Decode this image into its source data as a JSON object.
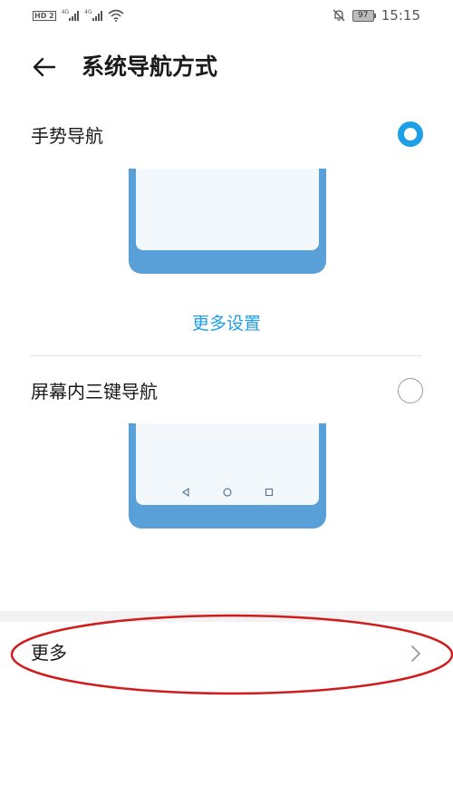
{
  "status_bar": {
    "hd_badge": "HD 2",
    "sim1_network": "4G",
    "sim2_network": "4G",
    "battery": "97",
    "time": "15:15",
    "icons": [
      "signal-icon",
      "wifi-icon",
      "mute-bell-icon",
      "battery-icon"
    ]
  },
  "header": {
    "title": "系统导航方式",
    "back_icon": "arrow-left-icon"
  },
  "options": [
    {
      "label": "手势导航",
      "selected": true,
      "more_settings": "更多设置"
    },
    {
      "label": "屏幕内三键导航",
      "selected": false,
      "nav_icons": [
        "triangle-back-icon",
        "circle-home-icon",
        "square-recent-icon"
      ]
    }
  ],
  "more": {
    "label": "更多",
    "chevron_icon": "chevron-right-icon"
  },
  "colors": {
    "accent": "#1e9fe8",
    "phone_frame": "#5aa0d8",
    "annotation": "#d01c1c"
  }
}
